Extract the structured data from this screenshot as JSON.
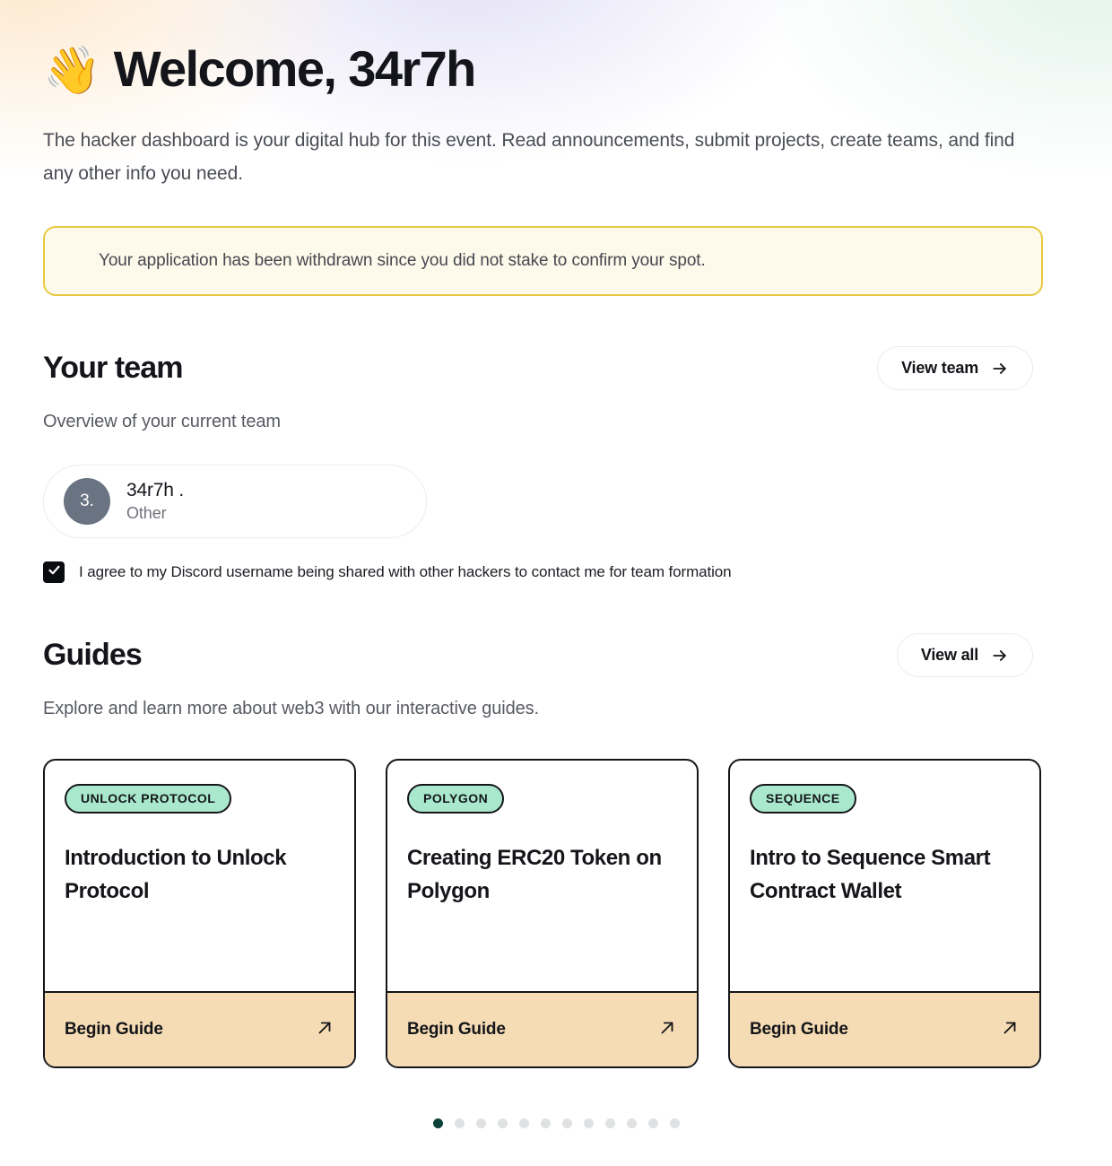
{
  "header": {
    "wave_emoji": "👋",
    "title": "Welcome, 34r7h",
    "intro": "The hacker dashboard is your digital hub for this event. Read announcements, submit projects, create teams, and find any other info you need."
  },
  "alert": {
    "message": "Your application has been withdrawn since you did not stake to confirm your spot.",
    "background_color": "#fdfaeb",
    "border_color": "#e8c93f"
  },
  "team": {
    "title": "Your team",
    "view_button_label": "View team",
    "subtitle": "Overview of your current team",
    "members": [
      {
        "initials": "3.",
        "name": "34r7h .",
        "role": "Other"
      }
    ],
    "consent_label": "I agree to my Discord username being shared with other hackers to contact me for team formation",
    "consent_checked": true
  },
  "guides": {
    "title": "Guides",
    "view_button_label": "View all",
    "subtitle": "Explore and learn more about web3 with our interactive guides.",
    "cards": [
      {
        "badge": "UNLOCK PROTOCOL",
        "title": "Introduction to Unlock Protocol",
        "cta": "Begin Guide"
      },
      {
        "badge": "POLYGON",
        "title": "Creating ERC20 Token on Polygon",
        "cta": "Begin Guide"
      },
      {
        "badge": "SEQUENCE",
        "title": "Intro to Sequence Smart Contract Wallet",
        "cta": "Begin Guide"
      }
    ],
    "badge_color": "#a9e8cd",
    "footer_color": "#f6dcb4"
  },
  "pagination": {
    "total_dots": 12,
    "active_index": 0,
    "active_color": "#0d4238",
    "inactive_color": "#dfe1e2"
  }
}
